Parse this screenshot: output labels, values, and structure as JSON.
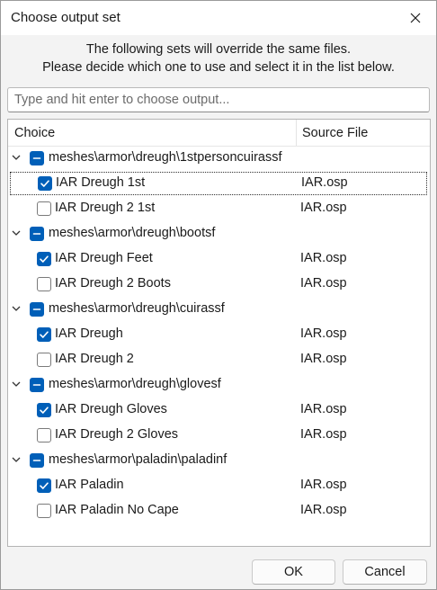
{
  "window": {
    "title": "Choose output set"
  },
  "intro": {
    "line1": "The following sets will override the same files.",
    "line2": "Please decide which one to use and select it in the list below."
  },
  "search": {
    "placeholder": "Type and hit enter to choose output..."
  },
  "columns": {
    "choice": "Choice",
    "source": "Source File"
  },
  "groups": [
    {
      "label": "meshes\\armor\\dreugh\\1stpersoncuirassf",
      "items": [
        {
          "label": "IAR Dreugh 1st",
          "source": "IAR.osp",
          "checked": true,
          "focused": true
        },
        {
          "label": "IAR Dreugh 2 1st",
          "source": "IAR.osp",
          "checked": false
        }
      ]
    },
    {
      "label": "meshes\\armor\\dreugh\\bootsf",
      "items": [
        {
          "label": "IAR Dreugh Feet",
          "source": "IAR.osp",
          "checked": true
        },
        {
          "label": "IAR Dreugh 2 Boots",
          "source": "IAR.osp",
          "checked": false
        }
      ]
    },
    {
      "label": "meshes\\armor\\dreugh\\cuirassf",
      "items": [
        {
          "label": "IAR Dreugh",
          "source": "IAR.osp",
          "checked": true
        },
        {
          "label": "IAR Dreugh 2",
          "source": "IAR.osp",
          "checked": false
        }
      ]
    },
    {
      "label": "meshes\\armor\\dreugh\\glovesf",
      "items": [
        {
          "label": "IAR Dreugh Gloves",
          "source": "IAR.osp",
          "checked": true
        },
        {
          "label": "IAR Dreugh 2 Gloves",
          "source": "IAR.osp",
          "checked": false
        }
      ]
    },
    {
      "label": "meshes\\armor\\paladin\\paladinf",
      "items": [
        {
          "label": "IAR Paladin",
          "source": "IAR.osp",
          "checked": true
        },
        {
          "label": "IAR Paladin No Cape",
          "source": "IAR.osp",
          "checked": false
        }
      ]
    }
  ],
  "buttons": {
    "ok": "OK",
    "cancel": "Cancel"
  },
  "colors": {
    "accent": "#005fb8"
  }
}
